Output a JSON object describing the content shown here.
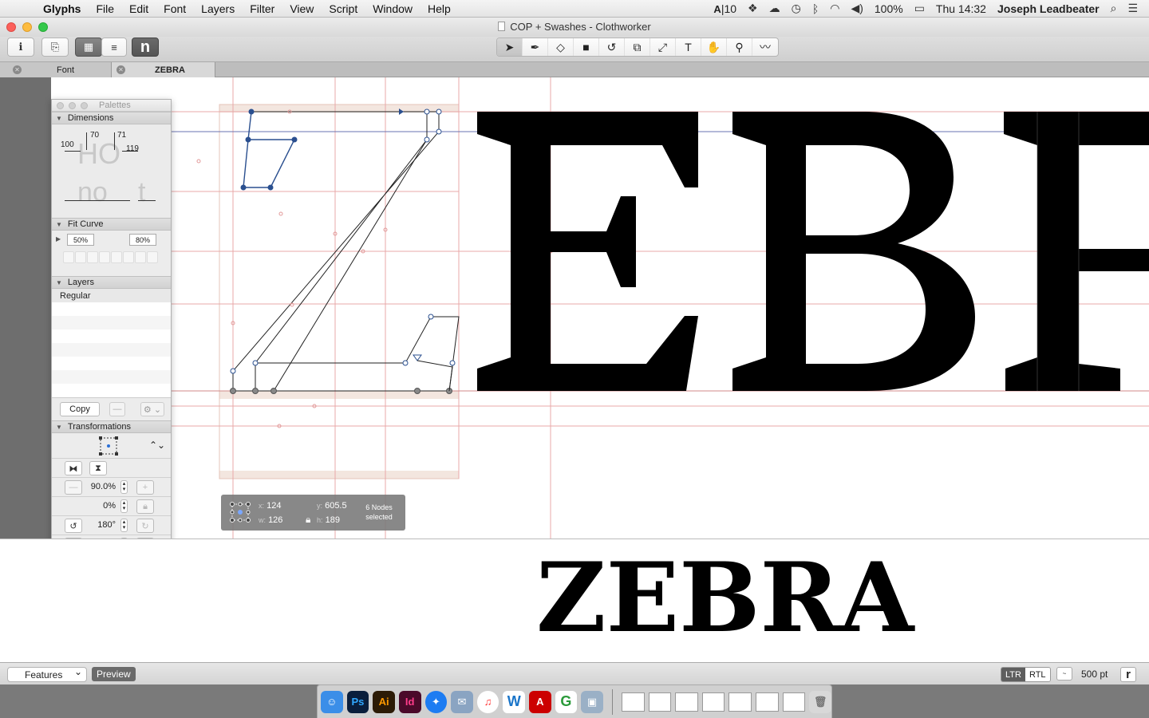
{
  "menubar": {
    "app": "Glyphs",
    "items": [
      "File",
      "Edit",
      "Font",
      "Layers",
      "Filter",
      "View",
      "Script",
      "Window",
      "Help"
    ],
    "status": {
      "adobe_count": "10",
      "battery": "100%",
      "clock": "Thu 14:32",
      "user": "Joseph Leadbeater"
    }
  },
  "window": {
    "title": "COP + Swashes - Clothworker"
  },
  "tabs": [
    {
      "label": "Font"
    },
    {
      "label": "ZEBRA"
    }
  ],
  "palettes": {
    "title": "Palettes",
    "dimensions": {
      "label": "Dimensions",
      "v100": "100",
      "v70": "70",
      "v71": "71",
      "v119": "119"
    },
    "fit_curve": {
      "label": "Fit Curve",
      "min": "50%",
      "max": "80%"
    },
    "layers": {
      "label": "Layers",
      "items": [
        "Regular"
      ]
    },
    "copy_label": "Copy",
    "transformations": {
      "label": "Transformations",
      "scale": "90.0%",
      "slant": "0%",
      "rotate": "180°"
    }
  },
  "selection_info": {
    "x_label": "x:",
    "x": "124",
    "y_label": "y:",
    "y": "605.5",
    "w_label": "w:",
    "w": "126",
    "h_label": "h:",
    "h": "189",
    "status_line1": "6 Nodes",
    "status_line2": "selected"
  },
  "preview": {
    "text": "ZEBRA"
  },
  "bottom": {
    "features": "Features",
    "preview_btn": "Preview",
    "ltr": "LTR",
    "rtl": "RTL",
    "size": "500 pt"
  },
  "colors": {
    "metric_line": "#e8a8a8",
    "selection": "#2a4f8f",
    "glyph": "#000000"
  }
}
